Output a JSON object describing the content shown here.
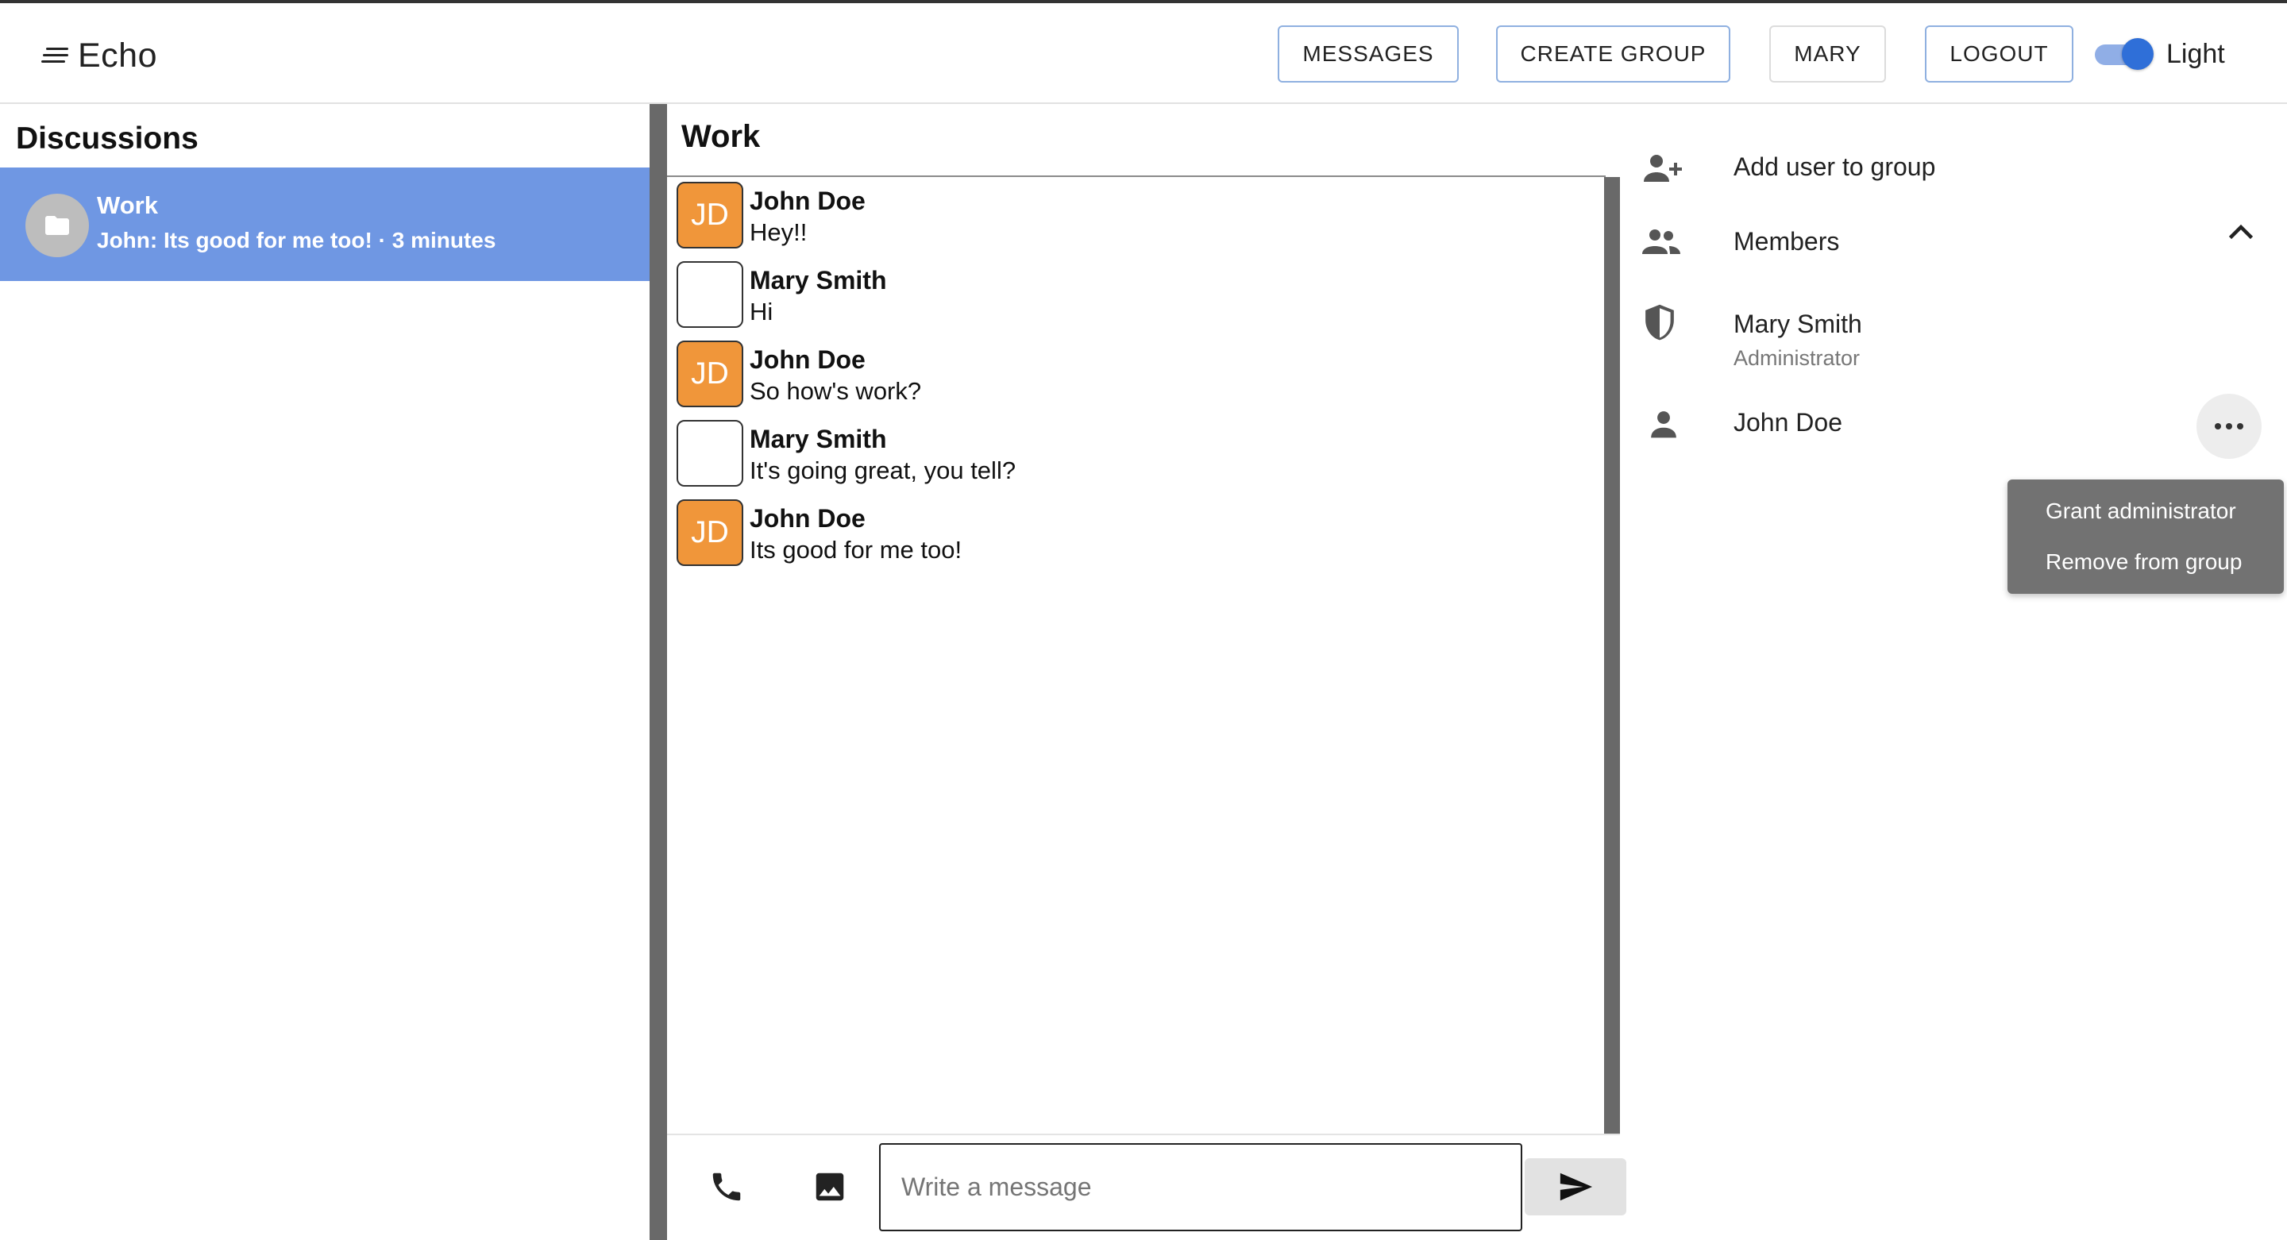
{
  "app": {
    "name": "Echo"
  },
  "header": {
    "buttons": {
      "messages": "MESSAGES",
      "create_group": "CREATE GROUP",
      "user": "MARY",
      "logout": "LOGOUT"
    },
    "theme_toggle": {
      "label": "Light",
      "on": true
    }
  },
  "sidebar": {
    "title": "Discussions",
    "items": [
      {
        "title": "Work",
        "subtitle": "John: Its good for me too! · 3 minutes",
        "icon": "folder-icon",
        "selected": true
      }
    ]
  },
  "chat": {
    "title": "Work",
    "messages": [
      {
        "initials": "JD",
        "author": "John Doe",
        "text": "Hey!!"
      },
      {
        "initials": "",
        "author": "Mary Smith",
        "text": "Hi"
      },
      {
        "initials": "JD",
        "author": "John Doe",
        "text": "So how's work?"
      },
      {
        "initials": "",
        "author": "Mary Smith",
        "text": "It's going great, you tell?"
      },
      {
        "initials": "JD",
        "author": "John Doe",
        "text": "Its good for me too!"
      }
    ],
    "composer": {
      "placeholder": "Write a message",
      "value": ""
    }
  },
  "group_panel": {
    "add_user": "Add user to group",
    "members_label": "Members",
    "members": [
      {
        "name": "Mary Smith",
        "role": "Administrator",
        "icon": "shield-icon"
      },
      {
        "name": "John Doe",
        "role": "",
        "icon": "person-icon"
      }
    ],
    "member_menu": {
      "grant": "Grant administrator",
      "remove": "Remove from group"
    }
  },
  "colors": {
    "selected_item": "#6f97e3",
    "avatar_orange": "#f0963a",
    "toggle_knob": "#2f6fd8",
    "divider": "#696969",
    "menu_bg": "#727272"
  }
}
